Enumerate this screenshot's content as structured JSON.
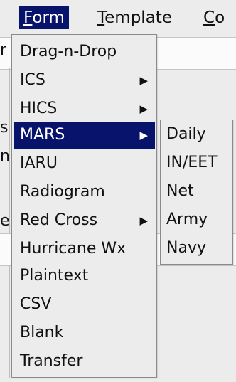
{
  "menubar": {
    "items": [
      {
        "label": "Form",
        "mnemonic": "F",
        "rest": "orm"
      },
      {
        "label": "Template",
        "mnemonic": "T",
        "rest": "emplate"
      },
      {
        "label": "Co",
        "mnemonic": "C",
        "rest": "o"
      }
    ]
  },
  "background": {
    "fragments": [
      "r",
      "s",
      "n",
      "ei"
    ]
  },
  "menu": {
    "items": [
      {
        "label": "Drag-n-Drop",
        "arrow": ""
      },
      {
        "label": "ICS",
        "arrow": "▶"
      },
      {
        "label": "HICS",
        "arrow": "▶"
      },
      {
        "label": "MARS",
        "arrow": "▶"
      },
      {
        "label": "IARU",
        "arrow": ""
      },
      {
        "label": "Radiogram",
        "arrow": ""
      },
      {
        "label": "Red Cross",
        "arrow": "▶"
      },
      {
        "label": "Hurricane Wx",
        "arrow": ""
      },
      {
        "label": "Plaintext",
        "arrow": ""
      },
      {
        "label": "CSV",
        "arrow": ""
      },
      {
        "label": "Blank",
        "arrow": ""
      },
      {
        "label": "Transfer",
        "arrow": ""
      }
    ],
    "highlighted": "MARS"
  },
  "submenu": {
    "parent": "MARS",
    "items": [
      {
        "label": "Daily"
      },
      {
        "label": "IN/EET"
      },
      {
        "label": "Net"
      },
      {
        "label": "Army"
      },
      {
        "label": "Navy"
      }
    ]
  },
  "colors": {
    "highlight": "#08136b",
    "menu_bg": "#ececec",
    "text": "#111111"
  }
}
